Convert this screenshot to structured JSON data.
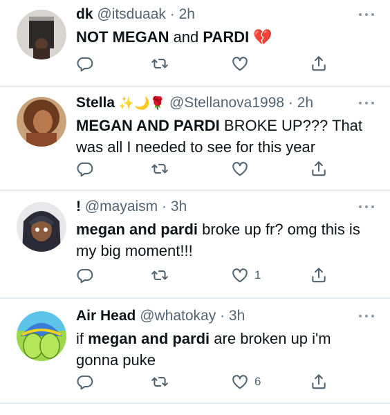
{
  "tweets": [
    {
      "name": "dk",
      "name_emojis": "",
      "handle": "@itsduaak",
      "time": "· 2h",
      "text_parts": [
        {
          "t": "NOT ",
          "b": false
        },
        {
          "t": "MEGAN",
          "b": true
        },
        {
          "t": " and ",
          "b": false
        },
        {
          "t": "PARDI",
          "b": true
        },
        {
          "t": " 💔",
          "b": false
        }
      ],
      "like_count": ""
    },
    {
      "name": "Stella",
      "name_emojis": "✨🌙🌹",
      "handle": "@Stellanova1998",
      "time": "· 2h",
      "text_parts": [
        {
          "t": "MEGAN AND PARDI",
          "b": true
        },
        {
          "t": " BROKE UP??? That was all I needed to see for this year",
          "b": false
        }
      ],
      "like_count": ""
    },
    {
      "name": "!",
      "name_emojis": "",
      "handle": "@mayaism",
      "time": "· 3h",
      "text_parts": [
        {
          "t": "megan and pardi",
          "b": true
        },
        {
          "t": " broke up fr? omg this is my big moment!!!",
          "b": false
        }
      ],
      "like_count": "1"
    },
    {
      "name": "Air Head",
      "name_emojis": "",
      "handle": "@whatokay",
      "time": "· 3h",
      "text_parts": [
        {
          "t": "if ",
          "b": false
        },
        {
          "t": "megan and pardi",
          "b": true
        },
        {
          "t": " are broken up i'm gonna puke",
          "b": false
        }
      ],
      "like_count": "6"
    }
  ],
  "icons": [
    "reply-icon",
    "retweet-icon",
    "like-icon",
    "share-icon",
    "more-icon"
  ],
  "colors": {
    "icon": "#536471",
    "divider": "#e6ecf0",
    "text": "#0f1419"
  }
}
